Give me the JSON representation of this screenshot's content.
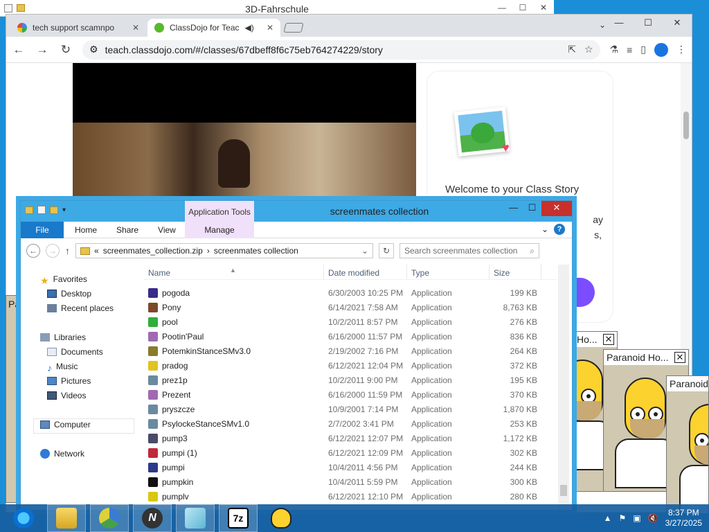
{
  "bg_app": {
    "title": "3D-Fahrschule",
    "controls": [
      "—",
      "☐",
      "✕"
    ]
  },
  "browser": {
    "tabs": [
      {
        "label": "tech support scamnpo",
        "close": "✕"
      },
      {
        "label": "ClassDojo for Teac",
        "audio": "◀)",
        "close": "✕"
      }
    ],
    "controls": [
      "—",
      "☐",
      "✕"
    ],
    "tab_search": "⌄",
    "nav": {
      "back": "←",
      "forward": "→",
      "reload": "↻"
    },
    "url": "teach.classdojo.com/#/classes/67dbeff8f6c75eb764274229/story",
    "omni_icons": [
      "⇱",
      "☆"
    ],
    "toolbar_icons": [
      "⚗",
      "≡",
      "▯"
    ],
    "profile": "👤",
    "menu": "⋮",
    "page": {
      "welcome": "Welcome to your Class Story",
      "frag1": "ay",
      "frag2": "s,",
      "heart": "♥"
    }
  },
  "screenmates": [
    {
      "title": "Ho...",
      "close": "✕"
    },
    {
      "title": "Paranoid Ho...",
      "close": "✕"
    },
    {
      "title": "Paranoid"
    }
  ],
  "left_fragment": "Pa",
  "explorer": {
    "quick_access": [
      "✓",
      "▾"
    ],
    "context_tab_group": "Application Tools",
    "title": "screenmates collection",
    "controls": [
      "—",
      "☐",
      "✕"
    ],
    "ribbon": {
      "file": "File",
      "tabs": [
        "Home",
        "Share",
        "View"
      ],
      "context_tab": "Manage",
      "expand": "⌄",
      "help": "?"
    },
    "nav": {
      "back": "←",
      "forward": "→",
      "up": "↑"
    },
    "breadcrumb": [
      "«",
      "screenmates_collection.zip",
      "›",
      "screenmates collection"
    ],
    "address_dropdown": "⌄",
    "refresh": "↻",
    "search_placeholder": "Search screenmates collection",
    "search_icon": "⌕",
    "nav_pane": {
      "favorites": "Favorites",
      "desktop": "Desktop",
      "recent": "Recent places",
      "libraries": "Libraries",
      "documents": "Documents",
      "music": "Music",
      "pictures": "Pictures",
      "videos": "Videos",
      "computer": "Computer",
      "network": "Network"
    },
    "columns": {
      "name": "Name",
      "date": "Date modified",
      "type": "Type",
      "size": "Size"
    },
    "files": [
      {
        "name": "pogoda",
        "date": "6/30/2003 10:25 PM",
        "type": "Application",
        "size": "199 KB",
        "color": "#3a2a8a"
      },
      {
        "name": "Pony",
        "date": "6/14/2021 7:58 AM",
        "type": "Application",
        "size": "8,763 KB",
        "color": "#7a4a2a"
      },
      {
        "name": "pool",
        "date": "10/2/2011 8:57 PM",
        "type": "Application",
        "size": "276 KB",
        "color": "#2fae3a"
      },
      {
        "name": "Pootin'Paul",
        "date": "6/16/2000 11:57 PM",
        "type": "Application",
        "size": "836 KB",
        "color": "#a06ab0"
      },
      {
        "name": "PotemkinStanceSMv3.0",
        "date": "2/19/2002 7:16 PM",
        "type": "Application",
        "size": "264 KB",
        "color": "#8a7a2a"
      },
      {
        "name": "pradog",
        "date": "6/12/2021 12:04 PM",
        "type": "Application",
        "size": "372 KB",
        "color": "#e0c420"
      },
      {
        "name": "prez1p",
        "date": "10/2/2011 9:00 PM",
        "type": "Application",
        "size": "195 KB",
        "color": "#6a8aa0"
      },
      {
        "name": "Prezent",
        "date": "6/16/2000 11:59 PM",
        "type": "Application",
        "size": "370 KB",
        "color": "#a06ab0"
      },
      {
        "name": "pryszcze",
        "date": "10/9/2001 7:14 PM",
        "type": "Application",
        "size": "1,870 KB",
        "color": "#6a8aa0"
      },
      {
        "name": "PsylockeStanceSMv1.0",
        "date": "2/7/2002 3:41 PM",
        "type": "Application",
        "size": "253 KB",
        "color": "#6a8aa0"
      },
      {
        "name": "pump3",
        "date": "6/12/2021 12:07 PM",
        "type": "Application",
        "size": "1,172 KB",
        "color": "#4a4a6a"
      },
      {
        "name": "pumpi (1)",
        "date": "6/12/2021 12:09 PM",
        "type": "Application",
        "size": "302 KB",
        "color": "#c02a3a"
      },
      {
        "name": "pumpi",
        "date": "10/4/2011 4:56 PM",
        "type": "Application",
        "size": "244 KB",
        "color": "#2a3a8a"
      },
      {
        "name": "pumpkin",
        "date": "10/4/2011 5:59 PM",
        "type": "Application",
        "size": "300 KB",
        "color": "#111111"
      },
      {
        "name": "pumplv",
        "date": "6/12/2021 12:10 PM",
        "type": "Application",
        "size": "280 KB",
        "color": "#d8c810"
      }
    ]
  },
  "taskbar": {
    "apps": [
      {
        "name": "internet-explorer",
        "label": ""
      },
      {
        "name": "file-explorer",
        "label": ""
      },
      {
        "name": "chrome",
        "label": ""
      },
      {
        "name": "app-n",
        "label": "N"
      },
      {
        "name": "glass",
        "label": ""
      },
      {
        "name": "7zip",
        "label": "7z"
      },
      {
        "name": "homer",
        "label": ""
      }
    ],
    "tray": [
      "▲",
      "⚑",
      "▣",
      "🔇"
    ],
    "time": "8:37 PM",
    "date": "3/27/2025"
  }
}
